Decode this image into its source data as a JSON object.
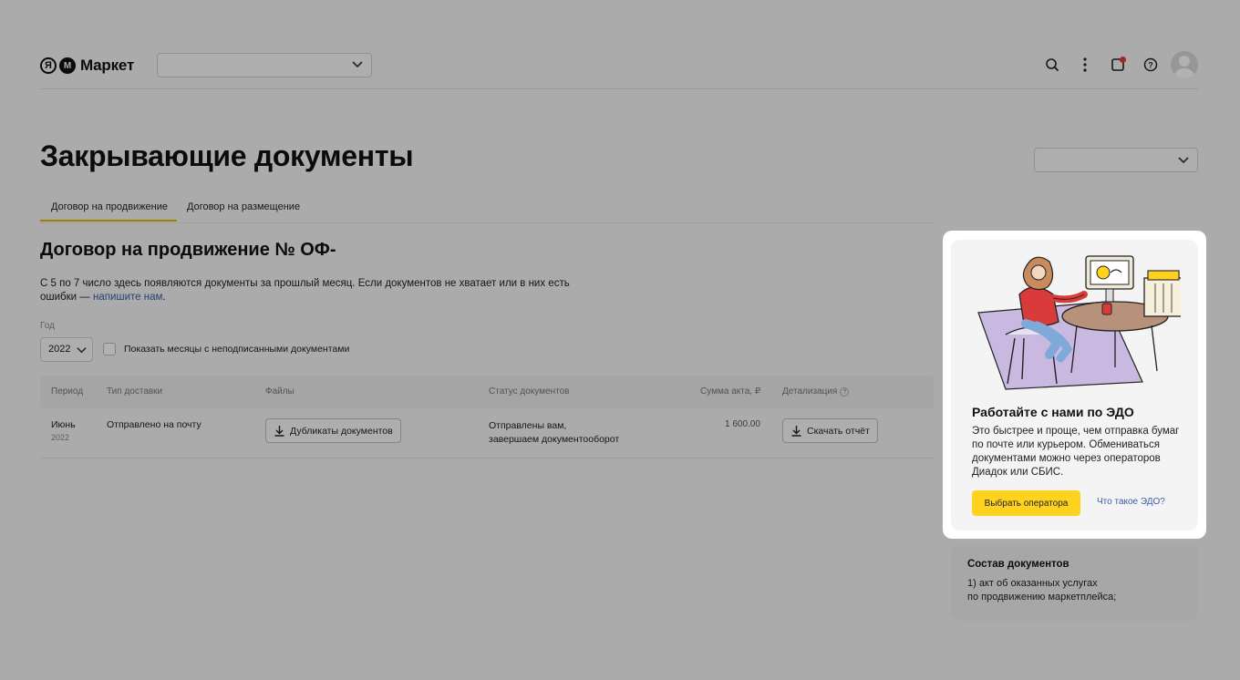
{
  "header": {
    "logo_ya": "Я",
    "logo_text": "Маркет",
    "shop_select_value": ""
  },
  "page": {
    "title": "Закрывающие документы",
    "period_select_value": ""
  },
  "tabs": [
    {
      "label": "Договор на продвижение",
      "active": true
    },
    {
      "label": "Договор на размещение",
      "active": false
    }
  ],
  "contract": {
    "title": "Договор на продвижение № ОФ-",
    "description": "С 5 по 7 число здесь появляются документы за прошлый месяц. Если документов не хватает или в них есть ошибки — ",
    "description_link": "напишите нам",
    "description_end": "."
  },
  "filters": {
    "year_label": "Год",
    "year_value": "2022",
    "checkbox_label": "Показать месяцы с неподписанными документами"
  },
  "table": {
    "headers": {
      "period": "Период",
      "delivery": "Тип доставки",
      "files": "Файлы",
      "status": "Статус документов",
      "sum": "Сумма акта, ₽",
      "details": "Детализация"
    },
    "rows": [
      {
        "month": "Июнь",
        "year": "2022",
        "delivery": "Отправлено на почту",
        "files_button": "Дубликаты документов",
        "status_line1": "Отправлены вам,",
        "status_line2": "завершаем документооборот",
        "sum": "1 600.00",
        "details_button": "Скачать отчёт"
      }
    ]
  },
  "promo": {
    "title": "Работайте с нами по ЭДО",
    "text": "Это быстрее и проще, чем отправка бумаг по почте или курьером. Обмениваться документами можно через операторов Диадок или СБИС.",
    "button": "Выбрать оператора",
    "link": "Что такое ЭДО?"
  },
  "docs": {
    "title": "Состав документов",
    "item1_line1": "1) акт об оказанных услугах",
    "item1_line2": "по продвижению маркетплейса;"
  },
  "colors": {
    "accent_yellow": "#ffd21f",
    "tab_underline": "#e8b400",
    "link": "#3a5fa8",
    "notification": "#e03a3a"
  }
}
